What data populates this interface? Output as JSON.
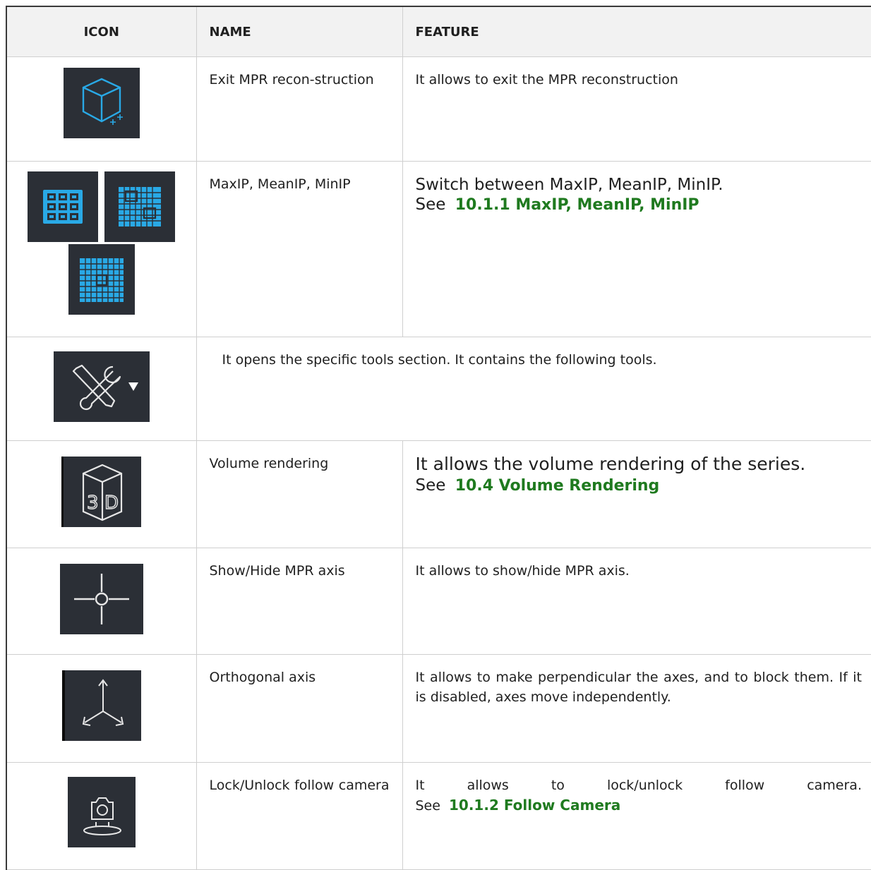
{
  "headers": {
    "icon": "ICON",
    "name": "NAME",
    "feature": "FEATURE"
  },
  "rows": [
    {
      "icon": "cube-plus-icon",
      "name": "Exit MPR recon-struction",
      "feature": "It allows to exit the MPR reconstruction"
    },
    {
      "icon": "projection-mode-icons",
      "name": "MaxIP, MeanIP, MinIP",
      "feature": "Switch between MaxIP, MeanIP, MinIP.",
      "see": "See",
      "link": "10.1.1 MaxIP, MeanIP, MinIP"
    },
    {
      "icon": "tools-dropdown-icon",
      "feature": "It opens the specific tools section. It contains the following tools."
    },
    {
      "icon": "volume-3d-icon",
      "name": "Volume rendering",
      "feature": "It allows the volume rendering of the series.",
      "see": "See",
      "link": "10.4 Volume Rendering"
    },
    {
      "icon": "crosshair-axis-icon",
      "name": "Show/Hide MPR axis",
      "feature": "It allows to show/hide MPR axis."
    },
    {
      "icon": "orthogonal-axis-icon",
      "name": "Orthogonal axis",
      "feature": "It allows to make perpendicular the axes, and to block them. If it is disabled, axes move independently."
    },
    {
      "icon": "follow-camera-icon",
      "name": "Lock/Unlock follow camera",
      "feature": "It allows to lock/unlock follow camera.",
      "see": "See",
      "link": "10.1.2 Follow Camera"
    }
  ],
  "colors": {
    "icon_bg": "#2b2f36",
    "icon_blue": "#29a9e6",
    "link_green": "#1f7a1f"
  }
}
